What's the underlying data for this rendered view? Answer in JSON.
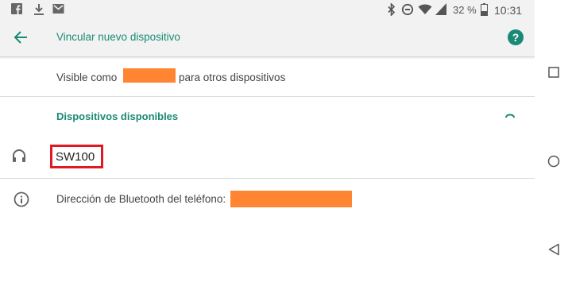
{
  "status_bar": {
    "battery_percent": "32 %",
    "time": "10:31",
    "left_icons": [
      "facebook-icon",
      "download-icon",
      "mail-icon"
    ],
    "right_icons": [
      "bluetooth-icon",
      "data-saver-icon",
      "wifi-icon",
      "signal-icon",
      "battery-icon"
    ]
  },
  "app_bar": {
    "title": "Vincular nuevo dispositivo",
    "back_icon": "arrow-back-icon",
    "help_icon": "help-icon",
    "accent_color": "#1a8a76"
  },
  "visibility": {
    "prefix": "Visible como",
    "suffix": "para otros dispositivos"
  },
  "available": {
    "title": "Dispositivos disponibles",
    "devices": [
      {
        "name": "SW100",
        "icon": "headset-icon"
      }
    ]
  },
  "info": {
    "label": "Dirección de Bluetooth del teléfono:",
    "icon": "info-icon"
  },
  "nav_bar": {
    "buttons": [
      "recents-square-icon",
      "home-circle-icon",
      "back-triangle-icon"
    ]
  },
  "colors": {
    "redaction": "#ff8533",
    "highlight": "#e01a25"
  }
}
